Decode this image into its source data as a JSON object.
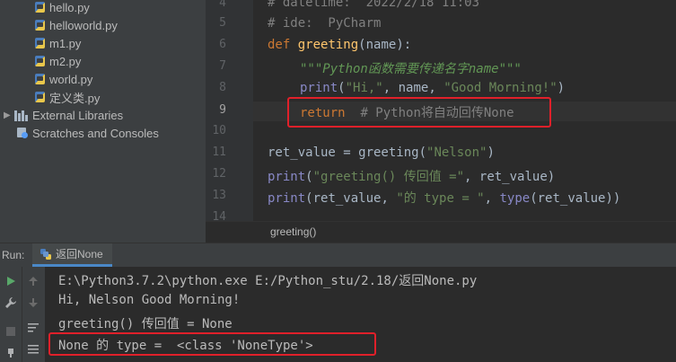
{
  "project_tree": {
    "items": [
      {
        "label": "hello.py"
      },
      {
        "label": "helloworld.py"
      },
      {
        "label": "m1.py"
      },
      {
        "label": "m2.py"
      },
      {
        "label": "world.py"
      },
      {
        "label": "定义类.py"
      }
    ],
    "external_libraries": "External Libraries",
    "scratches": "Scratches and Consoles"
  },
  "editor": {
    "line_numbers": [
      "4",
      "5",
      "6",
      "7",
      "8",
      "9",
      "10",
      "11",
      "12",
      "13",
      "14"
    ],
    "current_line": "9",
    "lines": {
      "l4_comment": "# datetime:  2022/2/18 11:03",
      "l5_comment": "# ide:  PyCharm",
      "l6_def": "def",
      "l6_name": "greeting",
      "l6_params": "(name):",
      "l7_doc": "\"\"\"Python函数需要传递名字name\"\"\"",
      "l8_print": "print",
      "l8_open": "(",
      "l8_str1": "\"Hi,\"",
      "l8_mid": ", name, ",
      "l8_str2": "\"Good Morning!\"",
      "l8_close": ")",
      "l9_return": "return",
      "l9_comment": "# Python将自动回传None",
      "l11_var": "ret_value = greeting(",
      "l11_str": "\"Nelson\"",
      "l11_close": ")",
      "l12_print": "print",
      "l12_open": "(",
      "l12_str": "\"greeting() 传回值 =\"",
      "l12_rest": ", ret_value)",
      "l13_print": "print",
      "l13_a": "(ret_value, ",
      "l13_str": "\"的 type = \"",
      "l13_b": ", ",
      "l13_type": "type",
      "l13_c": "(ret_value))"
    }
  },
  "breadcrumb": "greeting()",
  "run_panel": {
    "label": "Run:",
    "tab_label": "返回None",
    "output": [
      "E:\\Python3.7.2\\python.exe E:/Python_stu/2.18/返回None.py",
      "Hi, Nelson Good Morning!",
      "greeting() 传回值 = None",
      "None 的 type =  <class 'NoneType'>"
    ]
  },
  "colors": {
    "keyword": "#cc7832",
    "function": "#ffc66d",
    "builtin": "#8888c6",
    "string": "#6a8759",
    "comment": "#808080",
    "highlight_box": "#e0202a",
    "run_icon": "#59a869"
  },
  "icons": {
    "python_file": "python-file-icon",
    "library": "library-icon",
    "scratch": "scratch-icon",
    "run": "run-icon",
    "stop": "stop-icon",
    "wrench": "wrench-icon"
  }
}
